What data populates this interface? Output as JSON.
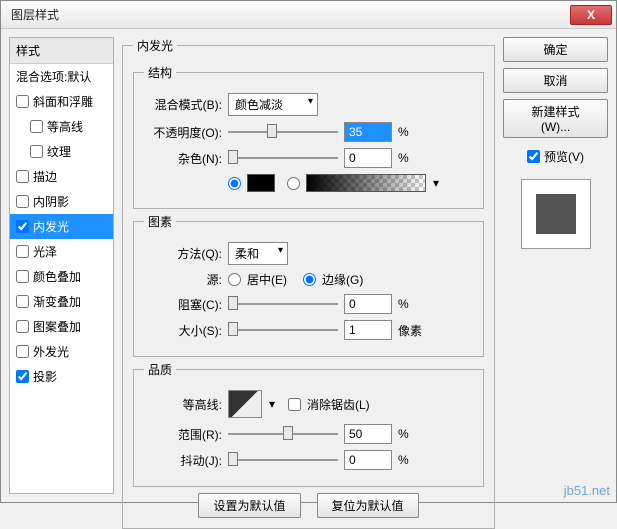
{
  "title": "图层样式",
  "close": "X",
  "sidebar": {
    "header": "样式",
    "items": [
      {
        "label": "混合选项:默认",
        "chk": null
      },
      {
        "label": "斜面和浮雕",
        "chk": false
      },
      {
        "label": "等高线",
        "chk": false,
        "indent": true
      },
      {
        "label": "纹理",
        "chk": false,
        "indent": true
      },
      {
        "label": "描边",
        "chk": false
      },
      {
        "label": "内阴影",
        "chk": false
      },
      {
        "label": "内发光",
        "chk": true,
        "selected": true
      },
      {
        "label": "光泽",
        "chk": false
      },
      {
        "label": "颜色叠加",
        "chk": false
      },
      {
        "label": "渐变叠加",
        "chk": false
      },
      {
        "label": "图案叠加",
        "chk": false
      },
      {
        "label": "外发光",
        "chk": false
      },
      {
        "label": "投影",
        "chk": true
      }
    ]
  },
  "panel": {
    "title": "内发光",
    "structure": {
      "legend": "结构",
      "blend_label": "混合模式(B):",
      "blend_value": "颜色减淡",
      "opacity_label": "不透明度(O):",
      "opacity_value": "35",
      "opacity_unit": "%",
      "noise_label": "杂色(N):",
      "noise_value": "0",
      "noise_unit": "%"
    },
    "elements": {
      "legend": "图素",
      "method_label": "方法(Q):",
      "method_value": "柔和",
      "source_label": "源:",
      "center_label": "居中(E)",
      "edge_label": "边缘(G)",
      "choke_label": "阻塞(C):",
      "choke_value": "0",
      "choke_unit": "%",
      "size_label": "大小(S):",
      "size_value": "1",
      "size_unit": "像素"
    },
    "quality": {
      "legend": "品质",
      "contour_label": "等高线:",
      "antialias_label": "消除锯齿(L)",
      "range_label": "范围(R):",
      "range_value": "50",
      "range_unit": "%",
      "jitter_label": "抖动(J):",
      "jitter_value": "0",
      "jitter_unit": "%"
    },
    "buttons": {
      "default": "设置为默认值",
      "reset": "复位为默认值"
    }
  },
  "right": {
    "ok": "确定",
    "cancel": "取消",
    "newstyle": "新建样式(W)...",
    "preview_label": "预览(V)"
  },
  "watermark": "jb51.net"
}
